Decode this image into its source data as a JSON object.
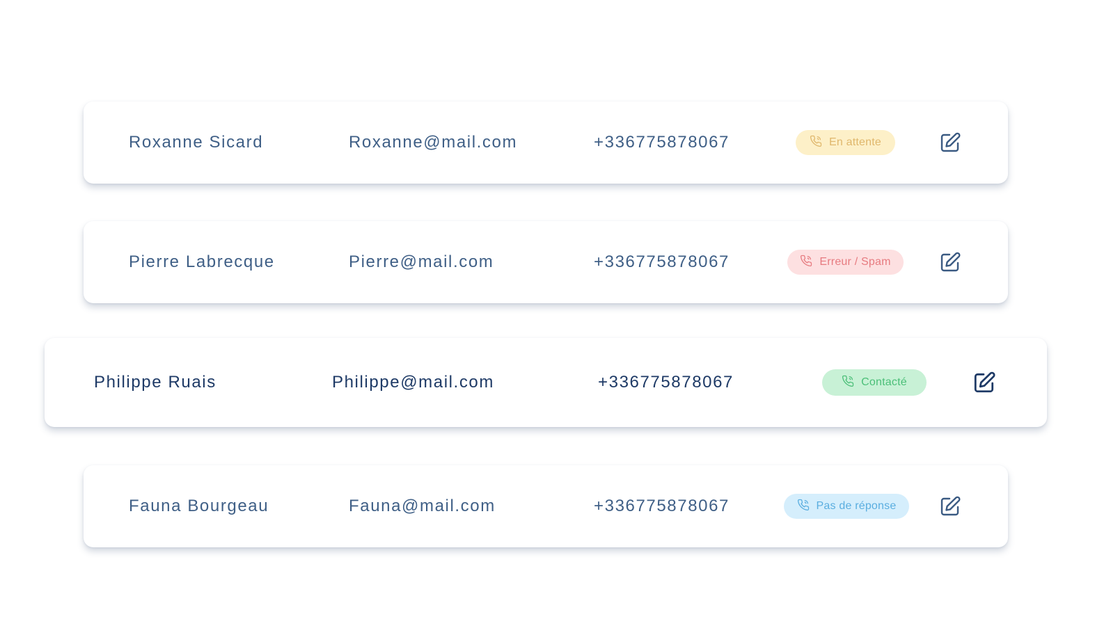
{
  "contacts": [
    {
      "name": "Roxanne Sicard",
      "email": "Roxanne@mail.com",
      "phone": "+336775878067",
      "status": "En attente",
      "status_bg": "#fdf0c8",
      "status_fg": "#e0b76c"
    },
    {
      "name": "Pierre Labrecque",
      "email": "Pierre@mail.com",
      "phone": "+336775878067",
      "status": "Erreur / Spam",
      "status_bg": "#fde0e1",
      "status_fg": "#e77b80"
    },
    {
      "name": "Philippe Ruais",
      "email": "Philippe@mail.com",
      "phone": "+336775878067",
      "status": "Contacté",
      "status_bg": "#c8f1d6",
      "status_fg": "#4bbf78"
    },
    {
      "name": "Fauna Bourgeau",
      "email": "Fauna@mail.com",
      "phone": "+336775878067",
      "status": "Pas de réponse",
      "status_bg": "#d5eefc",
      "status_fg": "#5aaee0"
    }
  ],
  "icons": {
    "status": "phone-icon",
    "edit": "edit-icon"
  },
  "colors": {
    "text": "#3f5f86",
    "text_active": "#1e3a66",
    "edit_icon": "#3a5a82",
    "edit_icon_active": "#1e3a66"
  }
}
